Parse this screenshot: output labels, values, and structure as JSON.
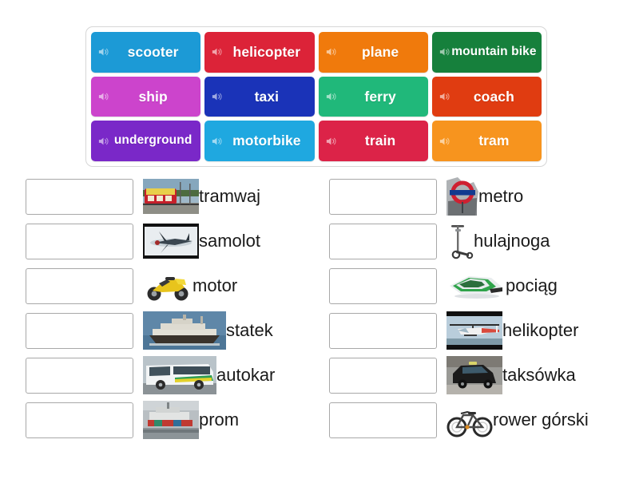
{
  "activity": {
    "type": "match-up",
    "word_bank": {
      "rows": 3,
      "columns": 4,
      "tiles": [
        {
          "label": "scooter",
          "color": "#1C9AD6",
          "icon": "speaker-icon"
        },
        {
          "label": "helicopter",
          "color": "#DC2338",
          "icon": "speaker-icon"
        },
        {
          "label": "plane",
          "color": "#F07A0C",
          "icon": "speaker-icon"
        },
        {
          "label": "mountain bike",
          "color": "#16803C",
          "icon": "speaker-icon"
        },
        {
          "label": "ship",
          "color": "#CC44CC",
          "icon": "speaker-icon"
        },
        {
          "label": "taxi",
          "color": "#1A33B8",
          "icon": "speaker-icon"
        },
        {
          "label": "ferry",
          "color": "#20B87A",
          "icon": "speaker-icon"
        },
        {
          "label": "coach",
          "color": "#E03C11",
          "icon": "speaker-icon"
        },
        {
          "label": "underground",
          "color": "#7A28C8",
          "icon": "speaker-icon"
        },
        {
          "label": "motorbike",
          "color": "#1FA8E0",
          "icon": "speaker-icon"
        },
        {
          "label": "train",
          "color": "#DC2348",
          "icon": "speaker-icon"
        },
        {
          "label": "tram",
          "color": "#F7941E",
          "icon": "speaker-icon"
        }
      ]
    },
    "answer_columns": {
      "left": [
        {
          "label": "tramwaj",
          "dropbox_value": "",
          "image": "tram-photo"
        },
        {
          "label": "samolot",
          "dropbox_value": "",
          "image": "airplane-photo"
        },
        {
          "label": "motor",
          "dropbox_value": "",
          "image": "motorbike-photo"
        },
        {
          "label": "statek",
          "dropbox_value": "",
          "image": "ship-photo"
        },
        {
          "label": "autokar",
          "dropbox_value": "",
          "image": "coach-bus-photo"
        },
        {
          "label": "prom",
          "dropbox_value": "",
          "image": "ferry-photo"
        }
      ],
      "right": [
        {
          "label": "metro",
          "dropbox_value": "",
          "image": "underground-roundel-photo"
        },
        {
          "label": "hulajnoga",
          "dropbox_value": "",
          "image": "kick-scooter-photo"
        },
        {
          "label": "pociąg",
          "dropbox_value": "",
          "image": "train-photo"
        },
        {
          "label": "helikopter",
          "dropbox_value": "",
          "image": "helicopter-photo"
        },
        {
          "label": "taksówka",
          "dropbox_value": "",
          "image": "taxi-photo"
        },
        {
          "label": "rower górski",
          "dropbox_value": "",
          "image": "mountain-bike-photo"
        }
      ]
    }
  }
}
